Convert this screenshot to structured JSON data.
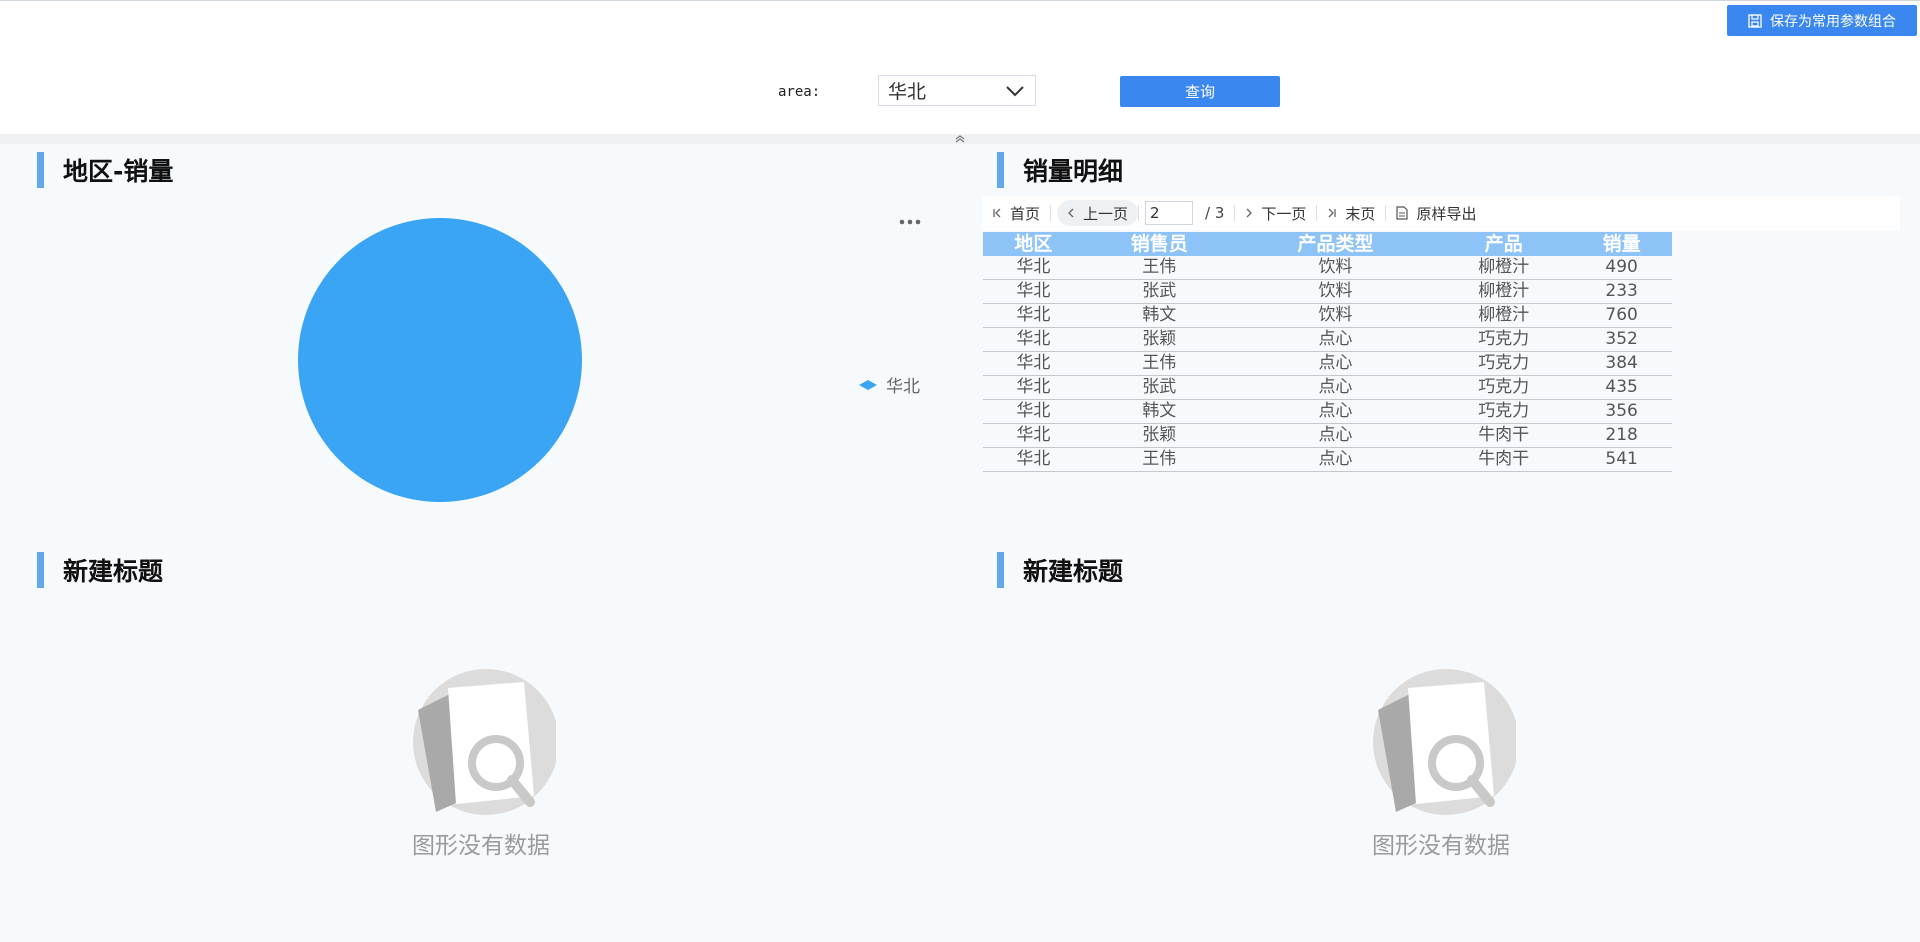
{
  "toolbar": {
    "save_params_label": "保存为常用参数组合"
  },
  "params": {
    "area_label": "area:",
    "area_value": "华北",
    "query_label": "查询"
  },
  "panels": {
    "pie": {
      "title": "地区-销量"
    },
    "detail": {
      "title": "销量明细"
    },
    "empty_left": {
      "title": "新建标题",
      "message": "图形没有数据"
    },
    "empty_right": {
      "title": "新建标题",
      "message": "图形没有数据"
    }
  },
  "pagination": {
    "first": "首页",
    "prev": "上一页",
    "current": "2",
    "total": "/ 3",
    "next": "下一页",
    "last": "末页",
    "export": "原样导出"
  },
  "table": {
    "headers": [
      "地区",
      "销售员",
      "产品类型",
      "产品",
      "销量"
    ],
    "rows": [
      [
        "华北",
        "王伟",
        "饮料",
        "柳橙汁",
        "490"
      ],
      [
        "华北",
        "张武",
        "饮料",
        "柳橙汁",
        "233"
      ],
      [
        "华北",
        "韩文",
        "饮料",
        "柳橙汁",
        "760"
      ],
      [
        "华北",
        "张颖",
        "点心",
        "巧克力",
        "352"
      ],
      [
        "华北",
        "王伟",
        "点心",
        "巧克力",
        "384"
      ],
      [
        "华北",
        "张武",
        "点心",
        "巧克力",
        "435"
      ],
      [
        "华北",
        "韩文",
        "点心",
        "巧克力",
        "356"
      ],
      [
        "华北",
        "张颖",
        "点心",
        "牛肉干",
        "218"
      ],
      [
        "华北",
        "王伟",
        "点心",
        "牛肉干",
        "541"
      ]
    ]
  },
  "chart_data": {
    "type": "pie",
    "title": "地区-销量",
    "categories": [
      "华北"
    ],
    "values": [
      1
    ],
    "colors": [
      "#3aa4f5"
    ],
    "legend": "right"
  },
  "colors": {
    "accent": "#3b87f0",
    "pie": "#3aa4f5",
    "header": "#8ec3f8",
    "title_bar": "#62a8ee"
  }
}
